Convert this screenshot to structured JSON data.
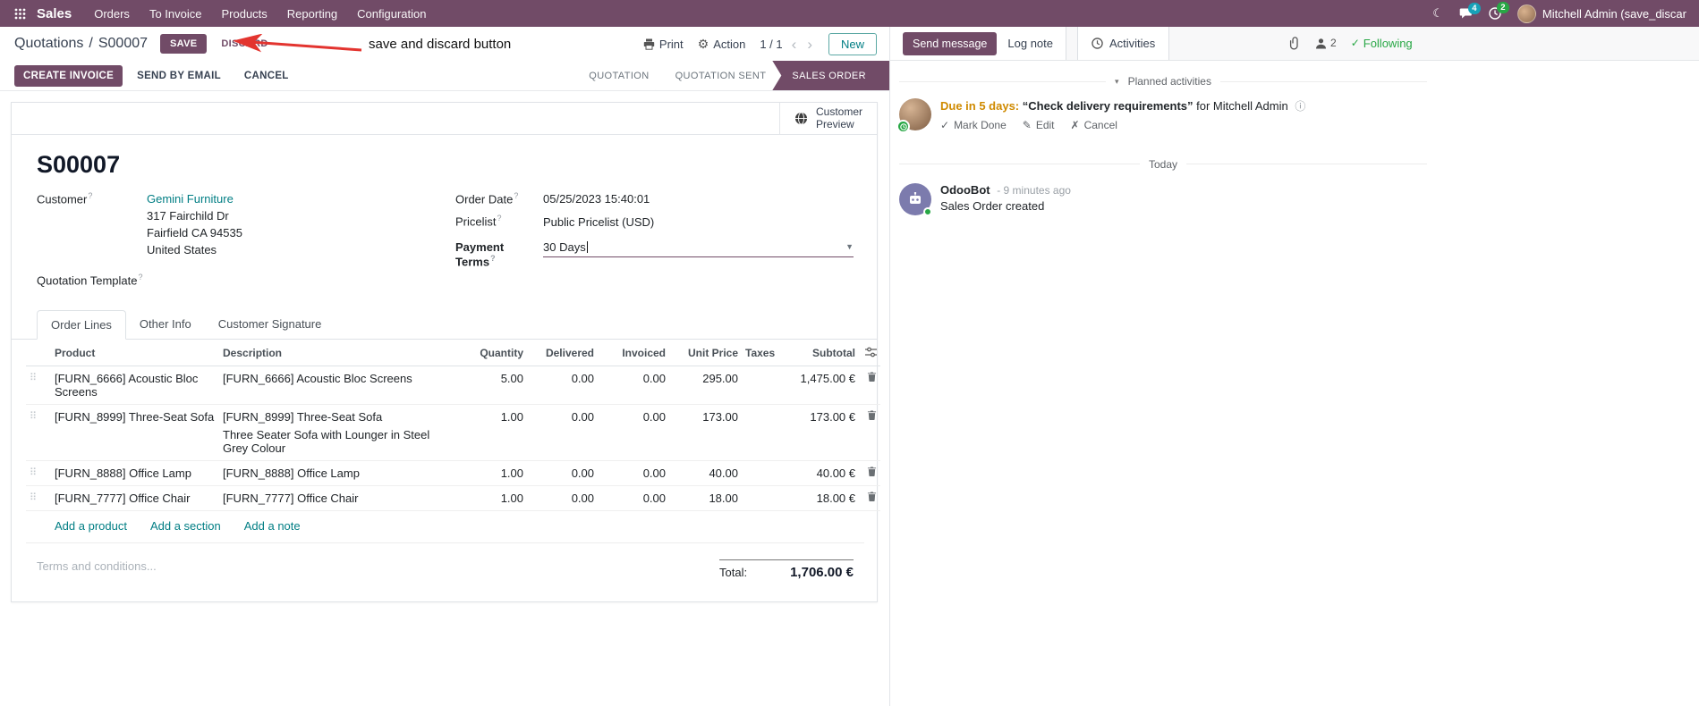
{
  "colors": {
    "brand_purple": "#714B67",
    "link_teal": "#017E84",
    "arrow_red": "#E3342F",
    "due_orange": "#CF8A00",
    "following_green": "#28A745",
    "messages_badge_blue": "#17A2B8",
    "activities_badge_green": "#28A745"
  },
  "topbar": {
    "app_name": "Sales",
    "menus": [
      "Orders",
      "To Invoice",
      "Products",
      "Reporting",
      "Configuration"
    ],
    "messages_badge": "4",
    "activities_badge": "2",
    "user_name": "Mitchell Admin (save_discar"
  },
  "control_panel": {
    "breadcrumb_parent": "Quotations",
    "breadcrumb_sep": "/",
    "breadcrumb_current": "S00007",
    "save_label": "SAVE",
    "discard_label": "DISCARD",
    "annotation": "save and discard button",
    "print_label": "Print",
    "action_label": "Action",
    "pager": "1 / 1",
    "new_label": "New"
  },
  "statusbar": {
    "create_invoice": "CREATE INVOICE",
    "send_by_email": "SEND BY EMAIL",
    "cancel": "CANCEL",
    "steps": [
      "QUOTATION",
      "QUOTATION SENT",
      "SALES ORDER"
    ],
    "active_step": "SALES ORDER"
  },
  "sheet": {
    "customer_preview_line1": "Customer",
    "customer_preview_line2": "Preview",
    "title": "S00007",
    "field_help": "?",
    "customer_label": "Customer",
    "customer_name": "Gemini Furniture",
    "address_line1": "317 Fairchild Dr",
    "address_line2": "Fairfield CA 94535",
    "address_line3": "United States",
    "quotation_template_label": "Quotation Template",
    "order_date_label": "Order Date",
    "order_date_value": "05/25/2023 15:40:01",
    "pricelist_label": "Pricelist",
    "pricelist_value": "Public Pricelist (USD)",
    "payment_terms_label": "Payment Terms",
    "payment_terms_value": "30 Days",
    "tabs": [
      "Order Lines",
      "Other Info",
      "Customer Signature"
    ],
    "table_headers": [
      "Product",
      "Description",
      "Quantity",
      "Delivered",
      "Invoiced",
      "Unit Price",
      "Taxes",
      "Subtotal"
    ],
    "rows": [
      {
        "product": "[FURN_6666] Acoustic Bloc Screens",
        "description": "[FURN_6666] Acoustic Bloc Screens",
        "quantity": "5.00",
        "delivered": "0.00",
        "invoiced": "0.00",
        "unit_price": "295.00",
        "taxes": "",
        "subtotal": "1,475.00 €"
      },
      {
        "product": "[FURN_8999] Three-Seat Sofa",
        "description": "[FURN_8999] Three-Seat Sofa",
        "description_line2": "Three Seater Sofa with Lounger in Steel Grey Colour",
        "quantity": "1.00",
        "delivered": "0.00",
        "invoiced": "0.00",
        "unit_price": "173.00",
        "taxes": "",
        "subtotal": "173.00 €"
      },
      {
        "product": "[FURN_8888] Office Lamp",
        "description": "[FURN_8888] Office Lamp",
        "quantity": "1.00",
        "delivered": "0.00",
        "invoiced": "0.00",
        "unit_price": "40.00",
        "taxes": "",
        "subtotal": "40.00 €"
      },
      {
        "product": "[FURN_7777] Office Chair",
        "description": "[FURN_7777] Office Chair",
        "quantity": "1.00",
        "delivered": "0.00",
        "invoiced": "0.00",
        "unit_price": "18.00",
        "taxes": "",
        "subtotal": "18.00 €"
      }
    ],
    "add_product": "Add a product",
    "add_section": "Add a section",
    "add_note": "Add a note",
    "terms_placeholder": "Terms and conditions...",
    "total_label": "Total:",
    "total_value": "1,706.00 €"
  },
  "chatter": {
    "send_message": "Send message",
    "log_note": "Log note",
    "activities_tab": "Activities",
    "followers_count": "2",
    "following": "Following",
    "planned_header": "Planned activities",
    "activity_due": "Due in 5 days:",
    "activity_summary": "“Check delivery requirements”",
    "activity_for": "for Mitchell Admin",
    "mark_done": "Mark Done",
    "edit": "Edit",
    "cancel": "Cancel",
    "today": "Today",
    "msg_author": "OdooBot",
    "msg_time": "- 9 minutes ago",
    "msg_body": "Sales Order created"
  }
}
